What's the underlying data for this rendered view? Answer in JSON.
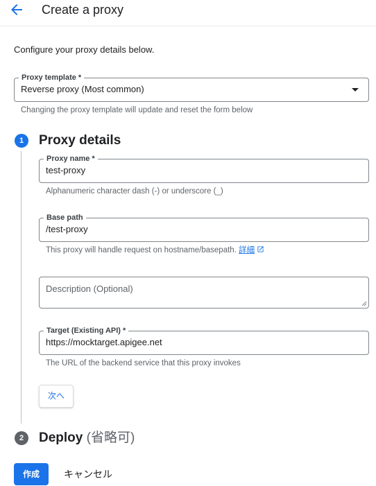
{
  "header": {
    "title": "Create a proxy"
  },
  "intro": "Configure your proxy details below.",
  "proxy_template": {
    "label": "Proxy template *",
    "value": "Reverse proxy (Most common)",
    "hint": "Changing the proxy template will update and reset the form below"
  },
  "steps": [
    {
      "number": "1",
      "title": "Proxy details",
      "optional": ""
    },
    {
      "number": "2",
      "title": "Deploy",
      "optional": "(省略可)"
    }
  ],
  "form": {
    "proxy_name": {
      "label": "Proxy name *",
      "value": "test-proxy",
      "hint": "Alphanumeric character dash (-) or underscore (_)"
    },
    "base_path": {
      "label": "Base path",
      "value": "/test-proxy",
      "hint": "This proxy will handle request on hostname/basepath.",
      "link": "詳細"
    },
    "description": {
      "placeholder": "Description (Optional)"
    },
    "target": {
      "label": "Target (Existing API) *",
      "value": "https://mocktarget.apigee.net",
      "hint": "The URL of the backend service that this proxy invokes"
    },
    "next_label": "次へ"
  },
  "footer": {
    "create_label": "作成",
    "cancel_label": "キャンセル"
  },
  "colors": {
    "accent": "#1a73e8",
    "step_active": "#1a73e8",
    "step_inactive": "#5f6368"
  }
}
